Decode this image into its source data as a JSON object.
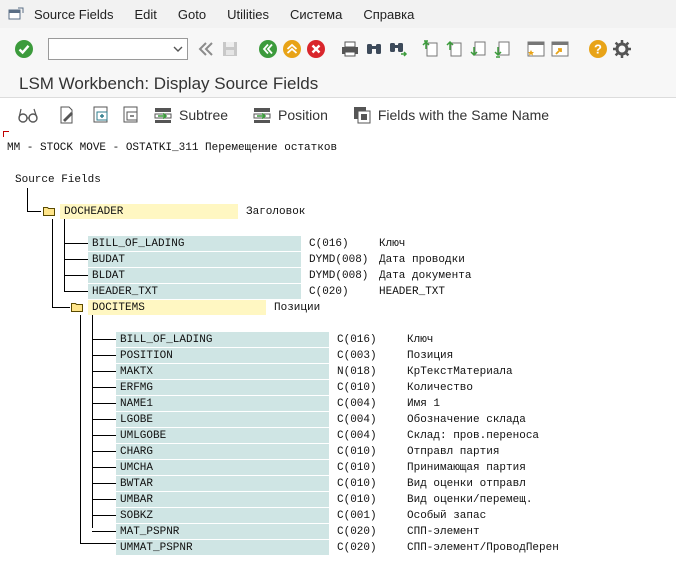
{
  "menu": [
    "Source Fields",
    "Edit",
    "Goto",
    "Utilities",
    "Система",
    "Справка"
  ],
  "menu_underline": [
    "S",
    "E",
    "G",
    "U",
    "",
    "С"
  ],
  "toolbar": {
    "command_placeholder": "",
    "icons": [
      "enter-check-icon",
      "back-icon",
      "save-icon",
      "exit-icon",
      "cancel-icon",
      "print-icon",
      "find-icon",
      "find-next-icon",
      "first-page-icon",
      "previous-page-icon",
      "next-page-icon",
      "last-page-icon",
      "new-session-icon",
      "shortcut-icon",
      "help-icon",
      "settings-icon"
    ]
  },
  "title": "LSM Workbench: Display Source Fields",
  "app_toolbar": {
    "subtree": "Subtree",
    "position": "Position",
    "same_name": "Fields with the Same Name"
  },
  "header_line": "MM - STOCK MOVE - OSTATKI_311 Перемещение остатков",
  "root_label": "Source Fields",
  "docheader": {
    "name": "DOCHEADER",
    "desc": "Заголовок",
    "fields": [
      {
        "name": "BILL_OF_LADING",
        "type": "C(016)",
        "desc": "Ключ"
      },
      {
        "name": "BUDAT",
        "type": "DYMD(008)",
        "desc": "Дата проводки"
      },
      {
        "name": "BLDAT",
        "type": "DYMD(008)",
        "desc": "Дата документа"
      },
      {
        "name": "HEADER_TXT",
        "type": "C(020)",
        "desc": "HEADER_TXT"
      }
    ]
  },
  "docitems": {
    "name": "DOCITEMS",
    "desc": "Позиции",
    "fields": [
      {
        "name": "BILL_OF_LADING",
        "type": "C(016)",
        "desc": "Ключ"
      },
      {
        "name": "POSITION",
        "type": "C(003)",
        "desc": "Позиция"
      },
      {
        "name": "MAKTX",
        "type": "N(018)",
        "desc": "КрТекстМатериала"
      },
      {
        "name": "ERFMG",
        "type": "C(010)",
        "desc": "Количество"
      },
      {
        "name": "NAME1",
        "type": "C(004)",
        "desc": "Имя 1"
      },
      {
        "name": "LGOBE",
        "type": "C(004)",
        "desc": "Обозначение склада"
      },
      {
        "name": "UMLGOBE",
        "type": "C(004)",
        "desc": "Склад: пров.переноса"
      },
      {
        "name": "CHARG",
        "type": "C(010)",
        "desc": "Отправл партия"
      },
      {
        "name": "UMCHA",
        "type": "C(010)",
        "desc": "Принимающая партия"
      },
      {
        "name": "BWTAR",
        "type": "C(010)",
        "desc": "Вид оценки отправл"
      },
      {
        "name": "UMBAR",
        "type": "C(010)",
        "desc": "Вид оценки/перемещ."
      },
      {
        "name": "SOBKZ",
        "type": "C(001)",
        "desc": "Особый запас"
      },
      {
        "name": "MAT_PSPNR",
        "type": "C(020)",
        "desc": "СПП-элемент"
      },
      {
        "name": "UMMAT_PSPNR",
        "type": "C(020)",
        "desc": "СПП-элемент/ПроводПерен"
      }
    ]
  }
}
